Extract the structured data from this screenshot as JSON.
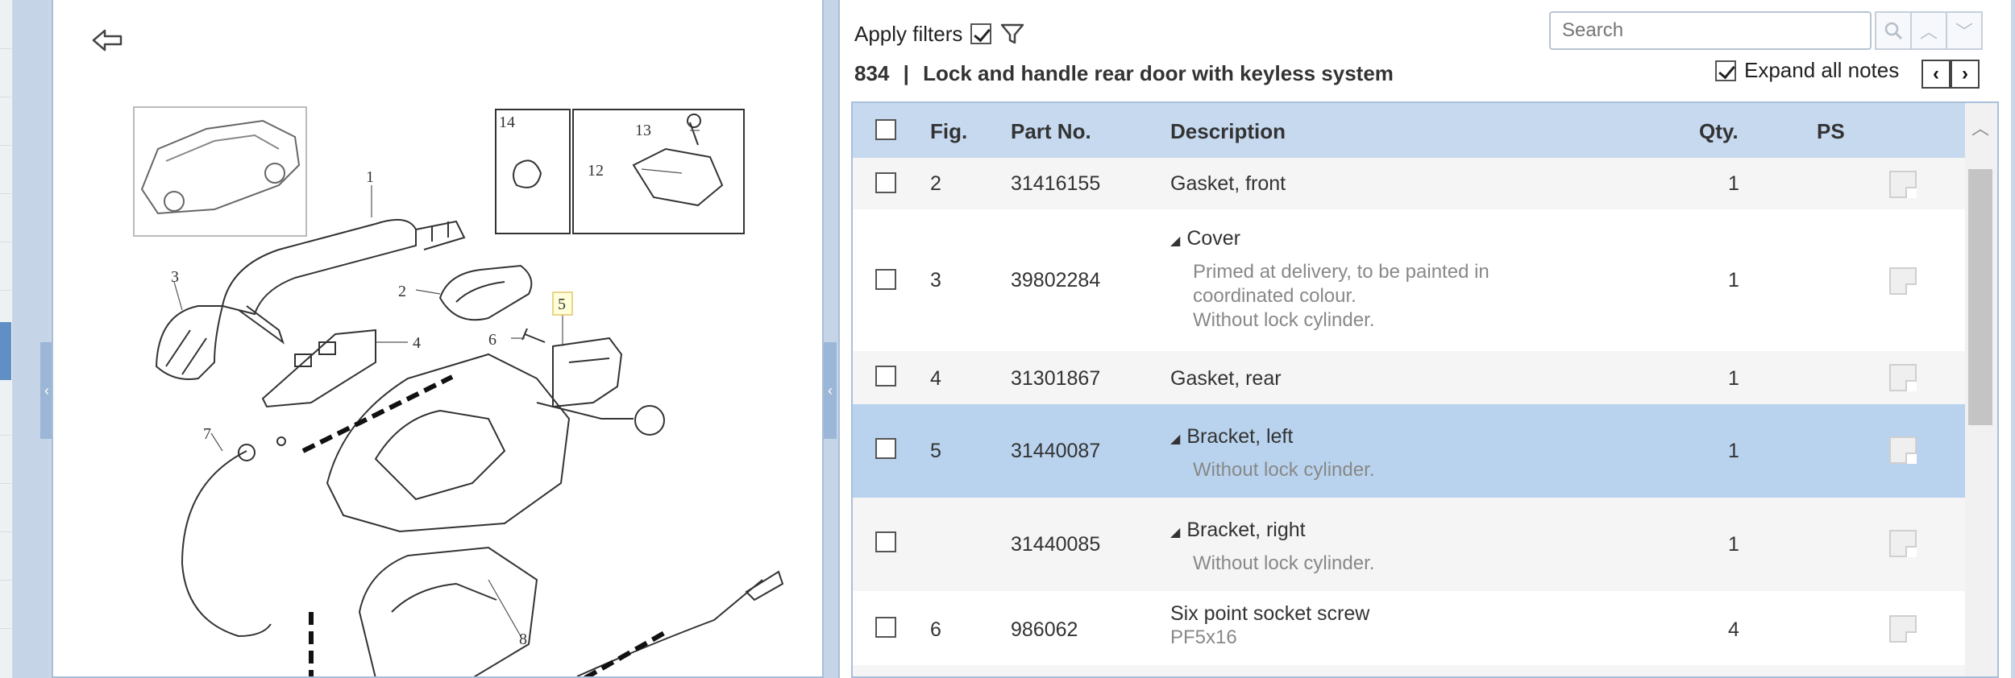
{
  "image_panel": {
    "back_icon": "back-arrow-icon",
    "diagram_labels": [
      "1",
      "2",
      "3",
      "4",
      "5",
      "6",
      "7",
      "8",
      "12",
      "13",
      "14"
    ]
  },
  "toolbar": {
    "apply_filters_label": "Apply filters",
    "apply_filters_checked": true,
    "filter_icon": "funnel-icon",
    "search_placeholder": "Search",
    "search_icon": "magnifier-icon",
    "prev_icon": "chevron-up-icon",
    "next_icon": "chevron-down-icon",
    "section_number": "834",
    "separator": "|",
    "section_title": "Lock and handle rear door with keyless system",
    "expand_notes_label": "Expand all notes",
    "expand_notes_checked": true,
    "nav_prev": "‹",
    "nav_next": "›"
  },
  "table": {
    "columns": {
      "fig": "Fig.",
      "part_no": "Part No.",
      "description": "Description",
      "qty": "Qty.",
      "ps": "PS"
    },
    "rows": [
      {
        "fig": "2",
        "part_no": "31416155",
        "description": "Gasket, front",
        "notes": [],
        "qty": "1"
      },
      {
        "fig": "3",
        "part_no": "39802284",
        "description": "Cover",
        "notes": [
          "Primed at delivery, to be painted in",
          "coordinated colour.",
          "Without lock cylinder."
        ],
        "qty": "1"
      },
      {
        "fig": "4",
        "part_no": "31301867",
        "description": "Gasket, rear",
        "notes": [],
        "qty": "1"
      },
      {
        "fig": "5",
        "part_no": "31440087",
        "description": "Bracket, left",
        "notes": [
          "Without lock cylinder."
        ],
        "qty": "1"
      },
      {
        "fig": "",
        "part_no": "31440085",
        "description": "Bracket, right",
        "notes": [
          "Without lock cylinder."
        ],
        "qty": "1"
      },
      {
        "fig": "6",
        "part_no": "986062",
        "description": "Six point socket screw",
        "notes": [
          "PF5x16"
        ],
        "qty": "4"
      }
    ]
  },
  "colors": {
    "header_bg": "#c6d9ef",
    "selected_row_bg": "#b9d3ee",
    "panel_border": "#a9bfd9"
  }
}
